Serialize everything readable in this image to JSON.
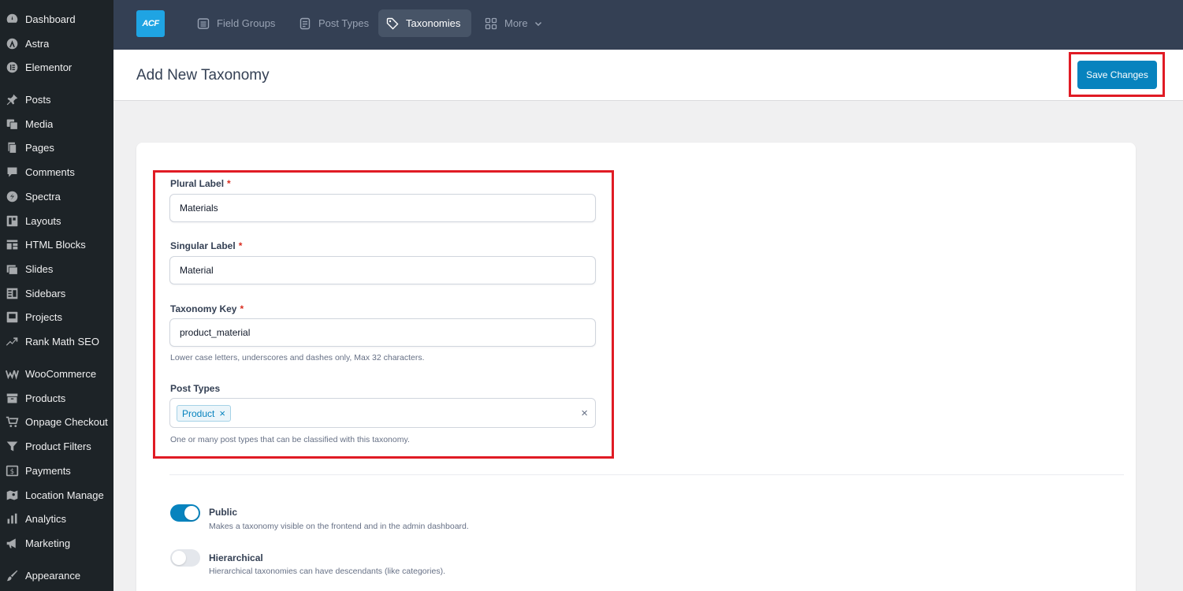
{
  "sidebar": {
    "items": [
      {
        "label": "Dashboard",
        "icon": "dashboard-icon"
      },
      {
        "label": "Astra",
        "icon": "astra-icon"
      },
      {
        "label": "Elementor",
        "icon": "elementor-icon"
      },
      {
        "label": "Posts",
        "icon": "pin-icon"
      },
      {
        "label": "Media",
        "icon": "media-icon"
      },
      {
        "label": "Pages",
        "icon": "pages-icon"
      },
      {
        "label": "Comments",
        "icon": "comment-icon"
      },
      {
        "label": "Spectra",
        "icon": "spectra-icon"
      },
      {
        "label": "Layouts",
        "icon": "layouts-icon"
      },
      {
        "label": "HTML Blocks",
        "icon": "blocks-icon"
      },
      {
        "label": "Slides",
        "icon": "slides-icon"
      },
      {
        "label": "Sidebars",
        "icon": "sidebars-icon"
      },
      {
        "label": "Projects",
        "icon": "projects-icon"
      },
      {
        "label": "Rank Math SEO",
        "icon": "rankmath-icon"
      },
      {
        "label": "WooCommerce",
        "icon": "woocommerce-icon"
      },
      {
        "label": "Products",
        "icon": "archive-icon"
      },
      {
        "label": "Onpage Checkout",
        "icon": "cart-icon"
      },
      {
        "label": "Product Filters",
        "icon": "filter-icon"
      },
      {
        "label": "Payments",
        "icon": "payments-icon"
      },
      {
        "label": "Location Manage",
        "icon": "location-icon"
      },
      {
        "label": "Analytics",
        "icon": "analytics-icon"
      },
      {
        "label": "Marketing",
        "icon": "megaphone-icon"
      },
      {
        "label": "Appearance",
        "icon": "brush-icon"
      }
    ]
  },
  "topbar": {
    "logo": "ACF",
    "tabs": [
      {
        "label": "Field Groups",
        "icon": "list-icon"
      },
      {
        "label": "Post Types",
        "icon": "document-icon"
      },
      {
        "label": "Taxonomies",
        "icon": "tag-icon",
        "active": true
      },
      {
        "label": "More",
        "icon": "grid-icon"
      }
    ]
  },
  "header": {
    "title": "Add New Taxonomy",
    "save_label": "Save Changes"
  },
  "form": {
    "plural_label": {
      "label": "Plural Label",
      "required": "*",
      "value": "Materials"
    },
    "singular_label": {
      "label": "Singular Label",
      "required": "*",
      "value": "Material"
    },
    "taxonomy_key": {
      "label": "Taxonomy Key",
      "required": "*",
      "value": "product_material",
      "help": "Lower case letters, underscores and dashes only, Max 32 characters."
    },
    "post_types": {
      "label": "Post Types",
      "selected": "Product",
      "remove": "×",
      "clear": "×",
      "help": "One or many post types that can be classified with this taxonomy."
    }
  },
  "toggles": [
    {
      "title": "Public",
      "description": "Makes a taxonomy visible on the frontend and in the admin dashboard.",
      "on": true
    },
    {
      "title": "Hierarchical",
      "description": "Hierarchical taxonomies can have descendants (like categories).",
      "on": false
    }
  ],
  "colors": {
    "sidebar_bg": "#1d2327",
    "topbar_bg": "#344054",
    "accent": "#0783be",
    "highlight": "#e01b24"
  }
}
